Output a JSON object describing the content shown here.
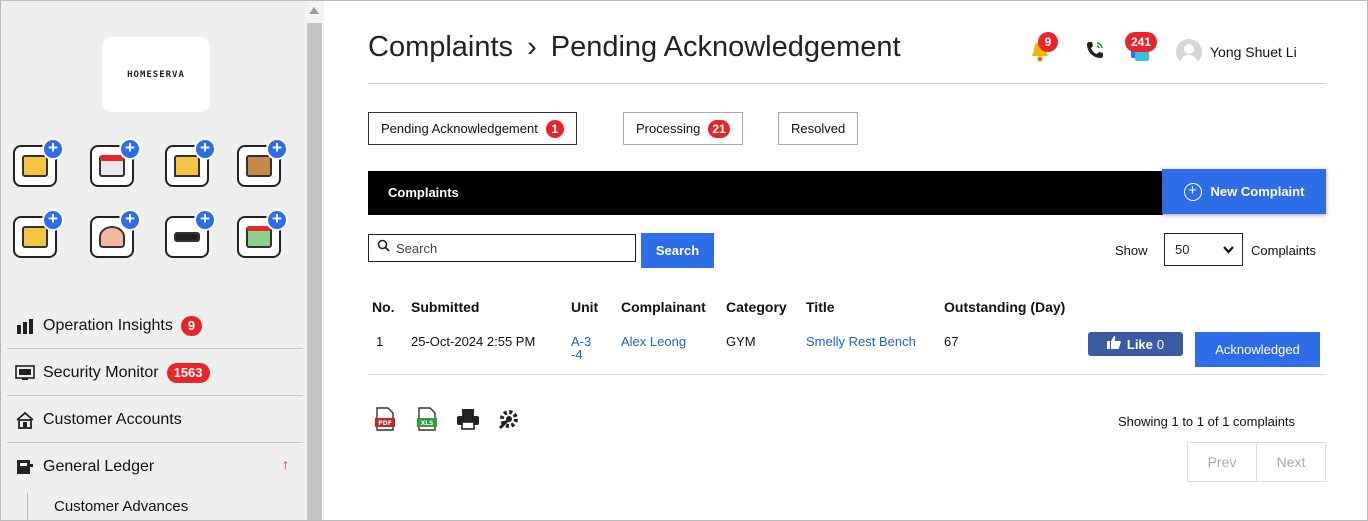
{
  "sidebar": {
    "logo_text": "HOMESERVA",
    "menu": [
      {
        "label": "Operation Insights",
        "badge": "9",
        "icon": "bar-chart-icon"
      },
      {
        "label": "Security Monitor",
        "badge": "1563",
        "icon": "cctv-monitor-icon"
      },
      {
        "label": "Customer Accounts",
        "icon": "house-icon"
      },
      {
        "label": "General Ledger",
        "icon": "ledger-icon",
        "indicator": "↑"
      }
    ],
    "sub_items": [
      {
        "label": "Customer Advances"
      }
    ]
  },
  "header": {
    "title": "Complaints",
    "separator": "›",
    "subtitle": "Pending Acknowledgement",
    "bell_badge": "9",
    "messages_badge": "241",
    "user_name": "Yong Shuet Li"
  },
  "tabs": [
    {
      "label": "Pending Acknowledgement",
      "badge": "1"
    },
    {
      "label": "Processing",
      "badge": "21"
    },
    {
      "label": "Resolved"
    }
  ],
  "section": {
    "title": "Complaints",
    "new_button": "New Complaint"
  },
  "search": {
    "placeholder": "Search",
    "button": "Search"
  },
  "show": {
    "prefix": "Show",
    "value": "50",
    "suffix": "Complaints"
  },
  "table": {
    "columns": [
      "No.",
      "Submitted",
      "Unit",
      "Complainant",
      "Category",
      "Title",
      "Outstanding (Day)"
    ],
    "rows": [
      {
        "no": "1",
        "submitted": "25-Oct-2024 2:55 PM",
        "unit": "A-3-4",
        "complainant": "Alex Leong",
        "category": "GYM",
        "title": "Smelly Rest Bench",
        "outstanding": "67"
      }
    ],
    "like_label": "Like",
    "like_count": "0",
    "ack_label": "Acknowledged"
  },
  "footer": {
    "showing": "Showing 1 to 1 of 1 complaints",
    "prev": "Prev",
    "next": "Next"
  },
  "colors": {
    "accent": "#2d6ee8",
    "badge": "#e8252a",
    "like": "#3b5ba3"
  }
}
